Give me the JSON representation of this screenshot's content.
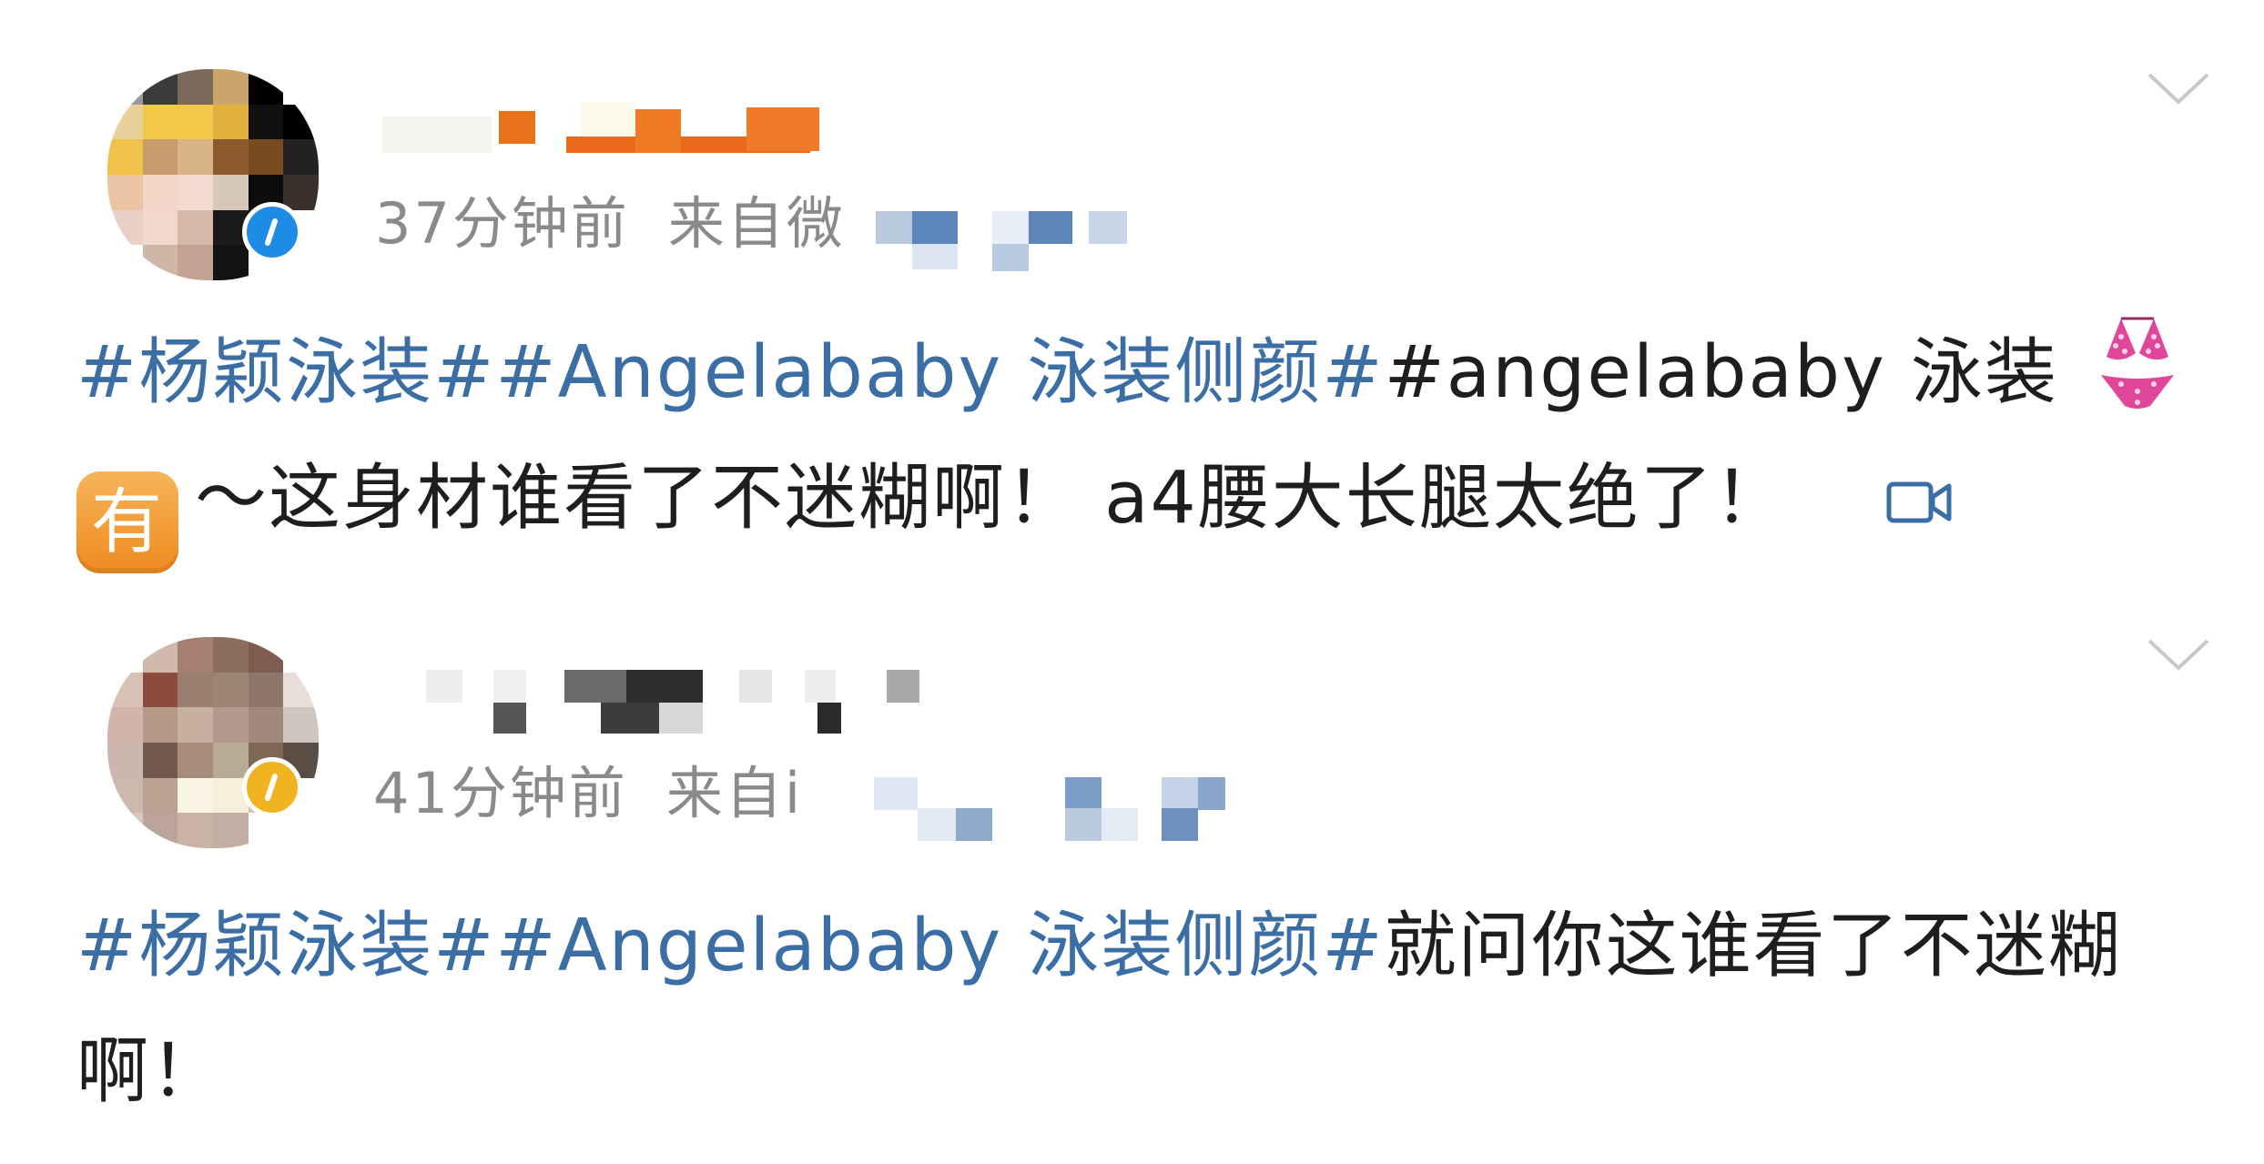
{
  "posts": [
    {
      "time": "37分钟前",
      "source_prefix": "来自微",
      "verify_color": "#1e8ce6",
      "content": {
        "tags": [
          "#杨颖泳装#",
          "#Angelababy 泳装侧颜#"
        ],
        "tail_tag": "angelababy",
        "text_a": " 泳装",
        "emoji_1": "bikini-emoji",
        "emoji_2": "有",
        "text_b": "～这身材谁看了不迷糊啊！ a4腰大长腿太绝了！",
        "icon": "video-icon"
      }
    },
    {
      "time": "41分钟前",
      "source_prefix": "来自i",
      "verify_color": "#f2b320",
      "content": {
        "tags": [
          "#杨颖泳装#",
          "#Angelababy 泳装侧颜#"
        ],
        "text": "就问你这谁看了不迷糊啊！"
      }
    }
  ],
  "colors": {
    "tag": "#3a6ea5",
    "body_text": "#1e1e1e",
    "meta_text": "#8a8a8a",
    "chevron": "#c8c8c8"
  }
}
